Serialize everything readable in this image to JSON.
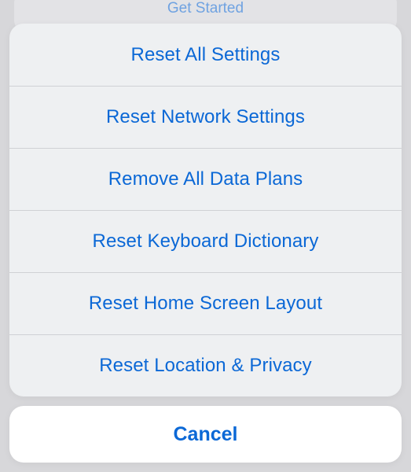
{
  "background_hint": "Get Started",
  "options": [
    {
      "label": "Reset All Settings"
    },
    {
      "label": "Reset Network Settings"
    },
    {
      "label": "Remove All Data Plans"
    },
    {
      "label": "Reset Keyboard Dictionary"
    },
    {
      "label": "Reset Home Screen Layout"
    },
    {
      "label": "Reset Location & Privacy"
    }
  ],
  "cancel_label": "Cancel"
}
